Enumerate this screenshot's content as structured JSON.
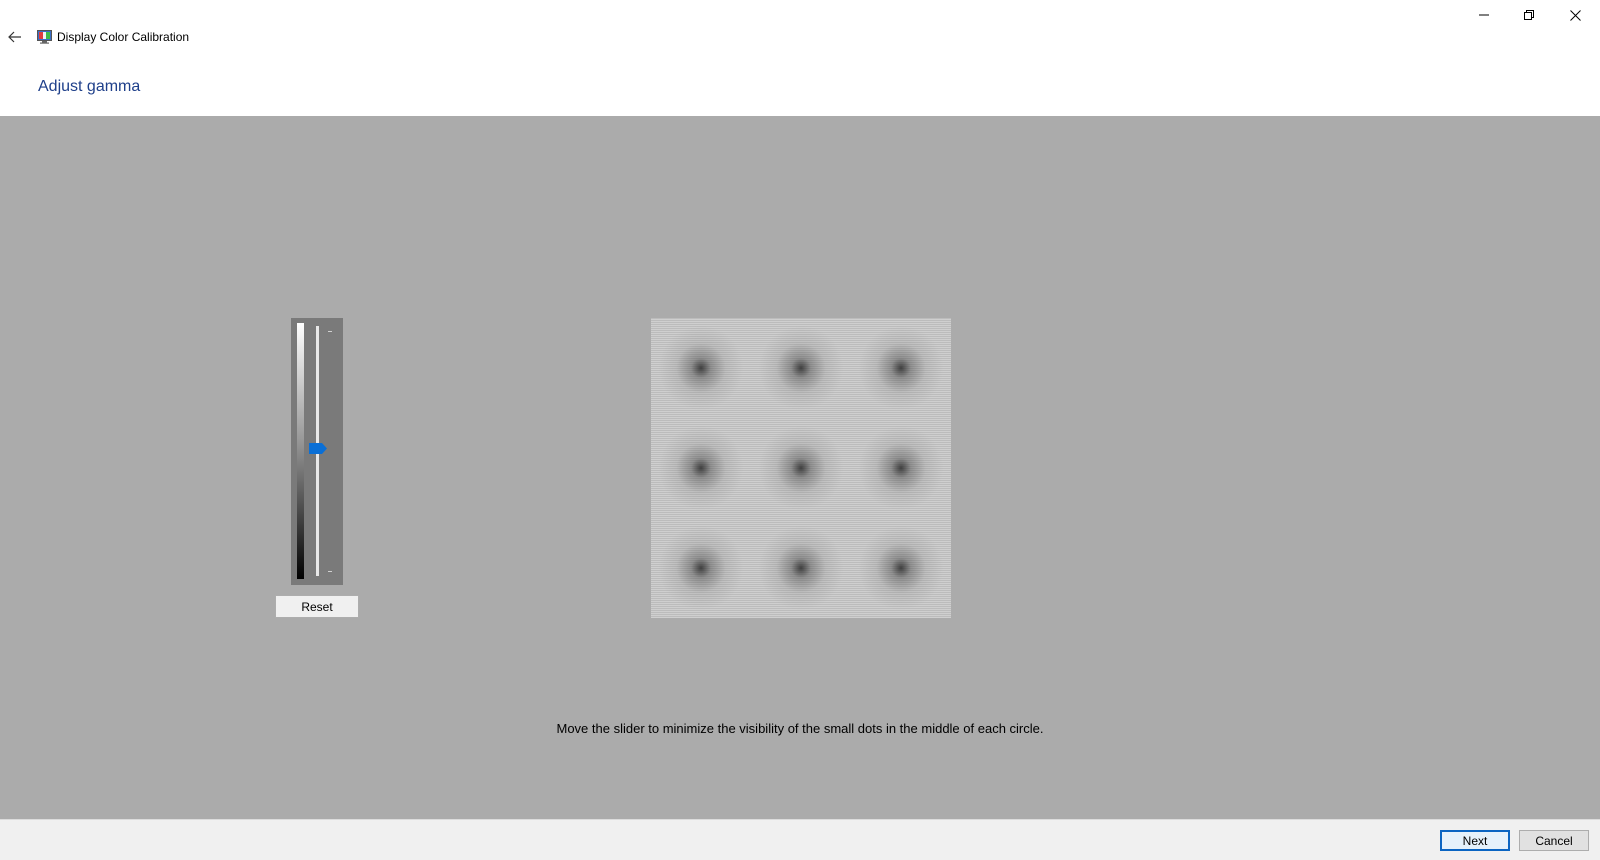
{
  "window": {
    "title": "Display Color Calibration",
    "controls": {
      "minimize_icon": "minimize-icon",
      "maximize_icon": "restore-icon",
      "close_icon": "close-icon"
    }
  },
  "header": {
    "back_icon": "back-arrow-icon",
    "page_title": "Adjust gamma"
  },
  "calibration": {
    "background_color": "#ababab",
    "slider": {
      "value_fraction": 0.51,
      "thumb_color": "#0a6fd6"
    },
    "reset_label": "Reset",
    "pattern": {
      "rows": 3,
      "columns": 3
    },
    "instruction": "Move the slider to minimize the visibility of the small dots in the middle of each circle."
  },
  "footer": {
    "next_label": "Next",
    "cancel_label": "Cancel"
  }
}
